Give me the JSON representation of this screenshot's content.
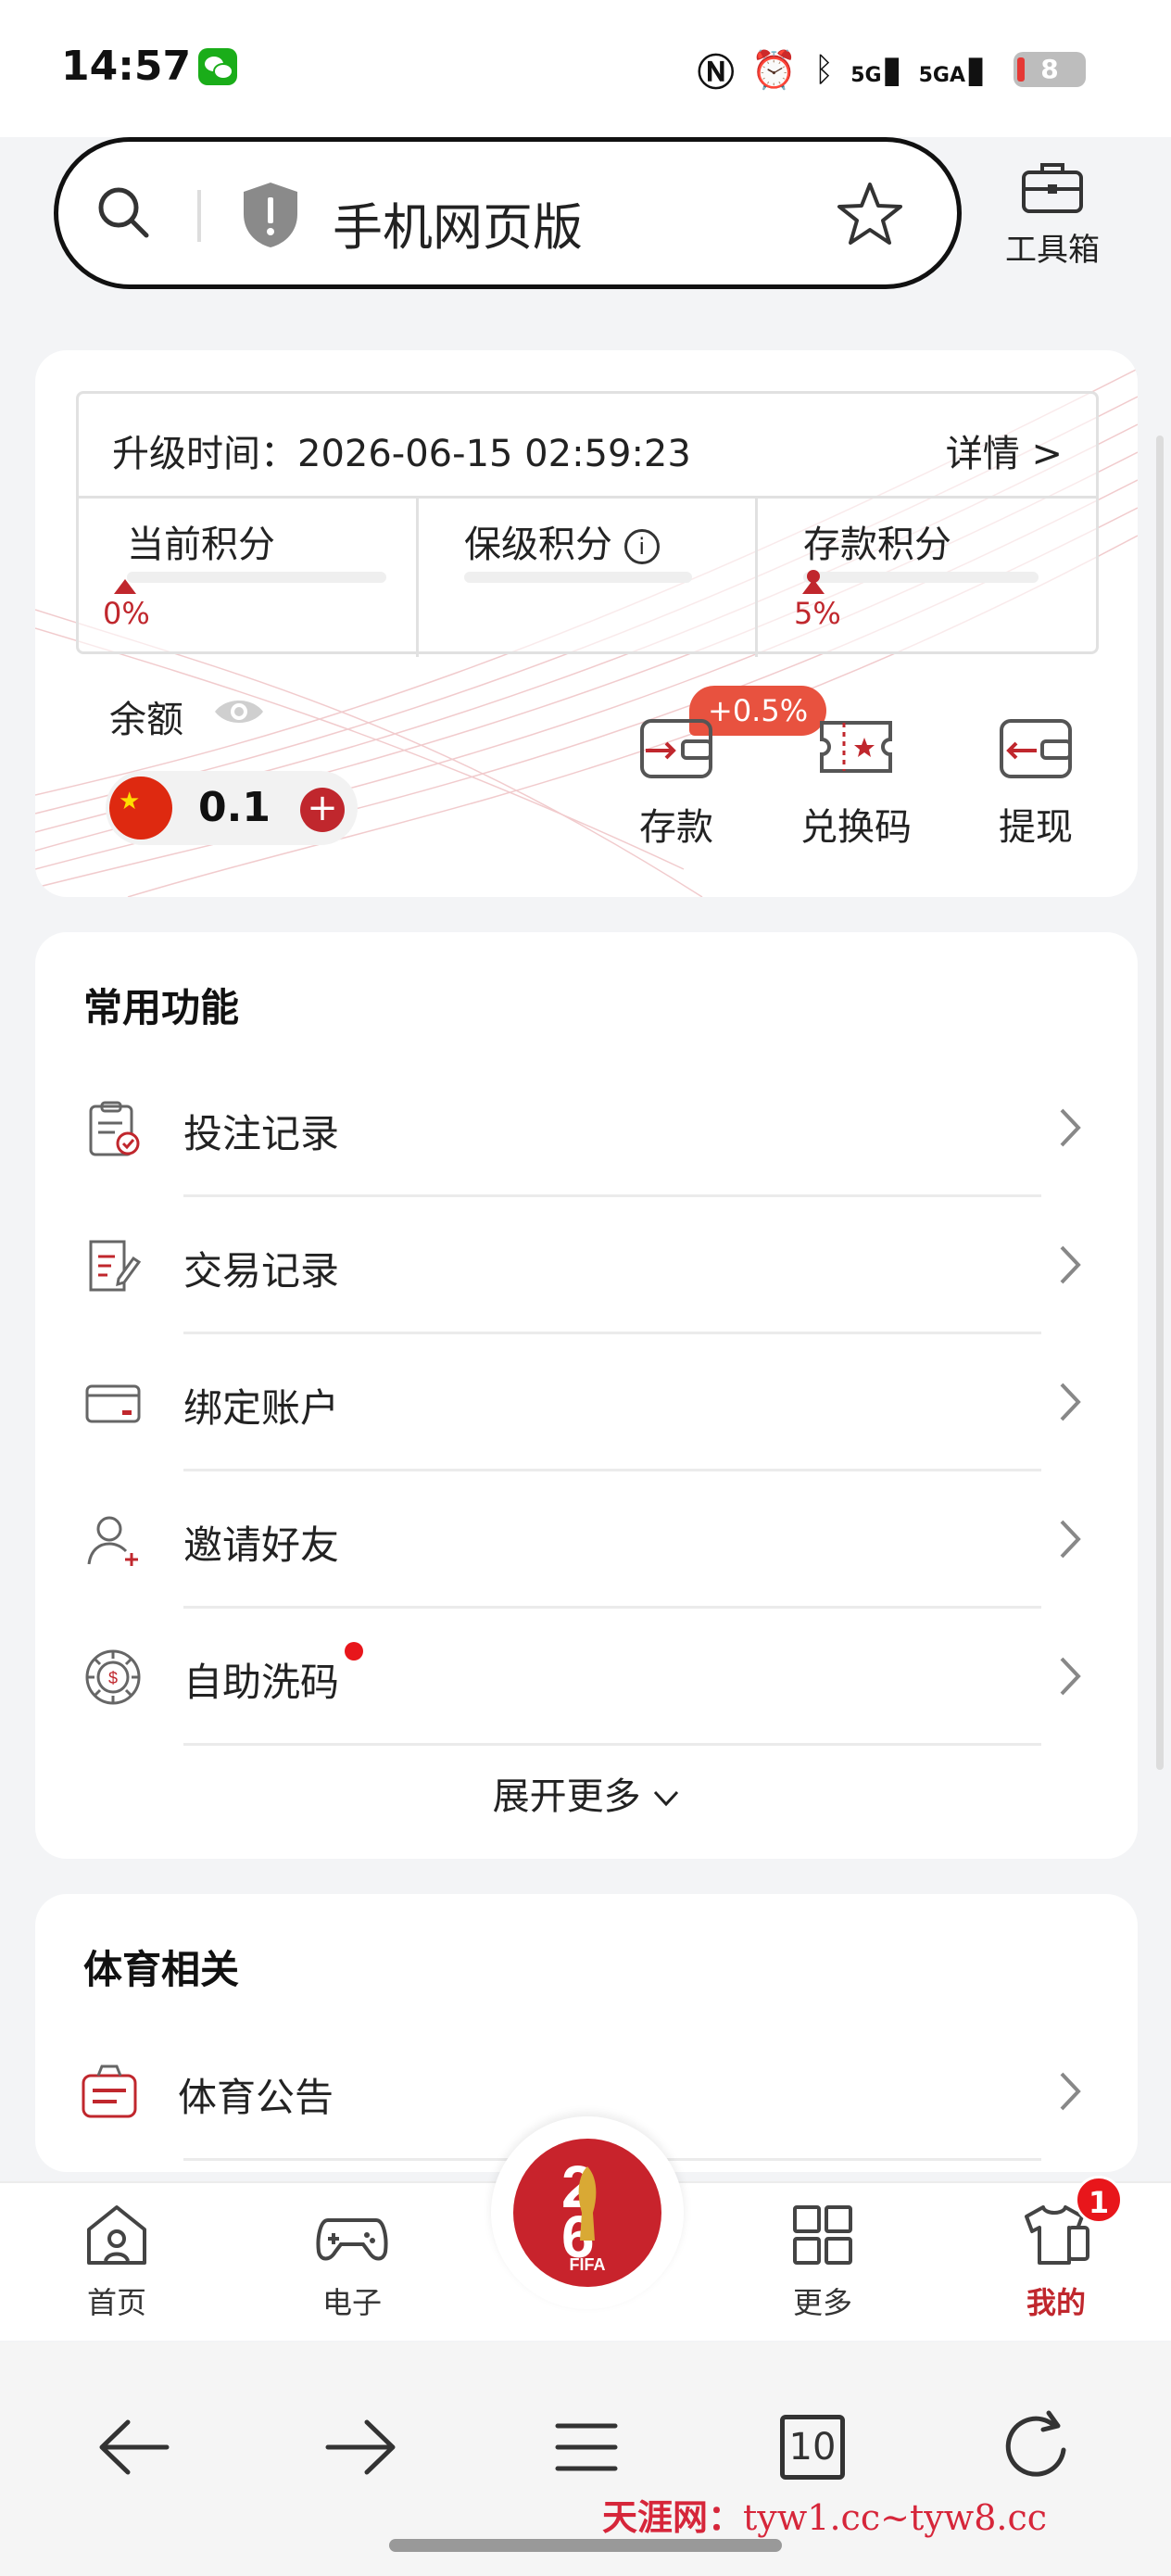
{
  "status_bar": {
    "time": "14:57",
    "signal_1": "5G",
    "signal_2": "5GA",
    "battery": "8"
  },
  "search": {
    "text": "手机网页版",
    "toolbox_label": "工具箱"
  },
  "vip": {
    "upgrade_label": "升级时间：",
    "upgrade_time": "2026-06-15 02:59:23",
    "detail": "详情 >",
    "scores": [
      {
        "label": "当前积分",
        "value": "0%"
      },
      {
        "label": "保级积分",
        "value": ""
      },
      {
        "label": "存款积分",
        "value": "5%"
      }
    ],
    "balance_label": "余额",
    "balance": "0.1",
    "deposit_badge": "+0.5%",
    "actions": [
      {
        "label": "存款",
        "icon": "deposit-icon"
      },
      {
        "label": "兑换码",
        "icon": "voucher-icon"
      },
      {
        "label": "提现",
        "icon": "withdraw-icon"
      }
    ]
  },
  "common": {
    "title": "常用功能",
    "items": [
      {
        "label": "投注记录",
        "icon": "clipboard-check-icon"
      },
      {
        "label": "交易记录",
        "icon": "document-edit-icon"
      },
      {
        "label": "绑定账户",
        "icon": "bank-card-icon"
      },
      {
        "label": "邀请好友",
        "icon": "user-add-icon"
      },
      {
        "label": "自助洗码",
        "icon": "chip-icon"
      }
    ],
    "expand": "展开更多"
  },
  "sports": {
    "title": "体育相关",
    "items": [
      {
        "label": "体育公告",
        "icon": "announcement-icon"
      }
    ]
  },
  "tabs": [
    {
      "label": "首页",
      "icon": "home-icon"
    },
    {
      "label": "电子",
      "icon": "gamepad-icon"
    },
    {
      "label": "更多",
      "icon": "grid-icon"
    },
    {
      "label": "我的",
      "icon": "shirt-icon"
    }
  ],
  "center_logo": "FIFA",
  "profile_badge": "1",
  "browser": {
    "tab_count": "10"
  },
  "watermark": {
    "site": "天涯网：",
    "url": "tyw1.cc~tyw8.cc"
  },
  "colors": {
    "accent": "#c0272d",
    "badge": "#e8523f"
  }
}
